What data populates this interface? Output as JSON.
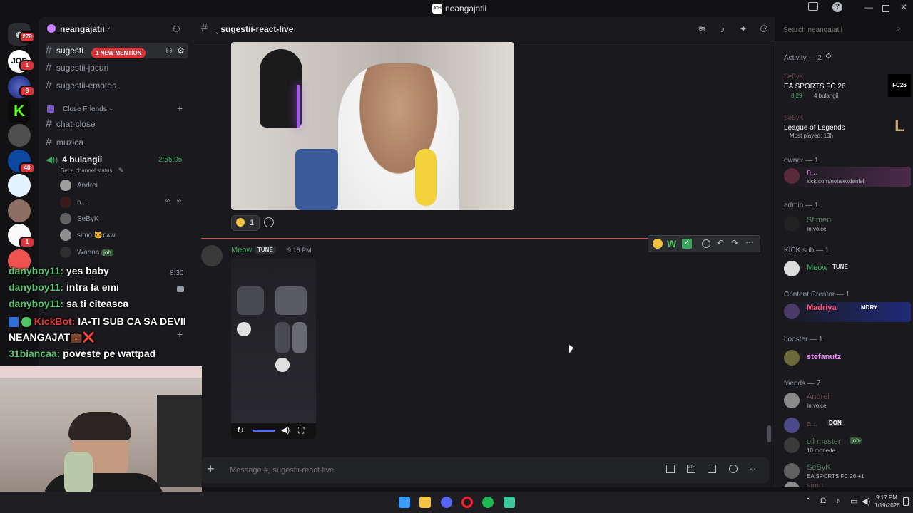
{
  "window": {
    "title": "neangajatii"
  },
  "servers": [
    {
      "name": "home",
      "badge": "278",
      "color": "#2b2d31"
    },
    {
      "name": "JOB",
      "badge": "1",
      "color": "#ffffff"
    },
    {
      "name": "server-3",
      "badge": "8",
      "color": "#1a237e"
    },
    {
      "name": "kick",
      "badge": "",
      "color": "#53fc18"
    },
    {
      "name": "server-5",
      "badge": "",
      "color": "#4e4e4e"
    },
    {
      "name": "server-6",
      "badge": "48",
      "color": "#0d47a1"
    },
    {
      "name": "server-7",
      "badge": "",
      "color": "#f5f5f5"
    },
    {
      "name": "server-8",
      "badge": "",
      "color": "#8d6e63"
    },
    {
      "name": "server-9",
      "badge": "",
      "color": "#ef5350"
    },
    {
      "name": "server-10",
      "badge": "1",
      "color": "#ff7043"
    }
  ],
  "sidebar": {
    "server_name": "neangajatii",
    "mention_badge": "1 NEW MENTION",
    "channels": [
      {
        "name": "sugesti"
      },
      {
        "name": "sugestii-jocuri"
      },
      {
        "name": "sugestii-emotes"
      }
    ],
    "category": "Close Friends",
    "category_channels": [
      {
        "name": "chat-close"
      },
      {
        "name": "muzica"
      }
    ],
    "voice": {
      "name": "4 bulangii",
      "timer": "2:55:05",
      "status_prompt": "Set a channel status",
      "users": [
        {
          "name": "Andrei",
          "tag": ""
        },
        {
          "name": "n...",
          "tag": ""
        },
        {
          "name": "SeByK",
          "tag": ""
        },
        {
          "name": "simo",
          "tag": "🐱ᴄᴀᴡ"
        },
        {
          "name": "Wanna",
          "tag": "job"
        }
      ]
    },
    "voice2_timer": "8:30"
  },
  "overlay_chat": [
    {
      "user": "danyboy11:",
      "text": "yes baby"
    },
    {
      "user": "danyboy11:",
      "text": "intra la emi"
    },
    {
      "user": "danyboy11:",
      "text": "sa ti citeasca"
    },
    {
      "user": "KickBot:",
      "text": "IA-TI SUB CA SA DEVII"
    },
    {
      "user": "",
      "text": "NEANGAJAT💼❌"
    },
    {
      "user": "31biancaa:",
      "text": "poveste pe wattpad"
    }
  ],
  "chat": {
    "channel_name": "ˎ sugestii-react-live",
    "search_placeholder": "Search neangajatii",
    "reaction_count": "1",
    "message": {
      "author": "Meow",
      "tag": "TUNE",
      "time": "9:16 PM"
    },
    "input_placeholder": "Message #ˎ sugestii-react-live"
  },
  "members": {
    "activity_header": "Activity — 2",
    "activities": [
      {
        "user": "SeByK",
        "game": "EA SPORTS FC 26",
        "detail": "8:29",
        "detail2": "4 bulangii",
        "art": "FC26"
      },
      {
        "user": "SeByK",
        "game": "League of Legends",
        "detail": "Most played: 13h",
        "detail2": "",
        "art": "L"
      }
    ],
    "groups": [
      {
        "title": "owner — 1",
        "members": [
          {
            "name": "n...",
            "status": "kick.com/notalexdaniel",
            "color": "#f47fff"
          }
        ]
      },
      {
        "title": "admin — 1",
        "members": [
          {
            "name": "Stimen",
            "status": "In voice",
            "color": "#5a7a5a"
          }
        ]
      },
      {
        "title": "KICK sub — 1",
        "members": [
          {
            "name": "Meow",
            "tag": "TUNE",
            "status": "",
            "color": "#3ba55c"
          }
        ]
      },
      {
        "title": "Content Creator — 1",
        "members": [
          {
            "name": "Madriya",
            "tag": "MDRY",
            "status": "",
            "color": "#ff4d6d"
          }
        ]
      },
      {
        "title": "booster — 1",
        "members": [
          {
            "name": "stefanutz",
            "status": "",
            "color": "#f47fff"
          }
        ]
      },
      {
        "title": "friends — 7",
        "members": [
          {
            "name": "Andrei",
            "status": "In voice",
            "color": "#6a4a4a"
          },
          {
            "name": "a...",
            "tag": "DON",
            "status": "",
            "color": "#6a4a4a"
          },
          {
            "name": "oil master",
            "tag": "job",
            "status": "10 monede",
            "color": "#5a7a5a"
          },
          {
            "name": "SeByK",
            "status": "EA SPORTS FC 26 +1",
            "color": "#5a7a5a"
          },
          {
            "name": "simo",
            "status": "",
            "color": "#6a4a4a"
          }
        ]
      }
    ]
  },
  "taskbar": {
    "time": "9:17 PM",
    "date": "1/19/2026",
    "apps": [
      {
        "name": "windows",
        "color": "#3b9cff"
      },
      {
        "name": "explorer",
        "color": "#f3c343"
      },
      {
        "name": "discord",
        "color": "#5865f2"
      },
      {
        "name": "opera",
        "color": "#ff1b2d"
      },
      {
        "name": "spotify",
        "color": "#1db954"
      },
      {
        "name": "app",
        "color": "#3ec79b"
      }
    ]
  }
}
